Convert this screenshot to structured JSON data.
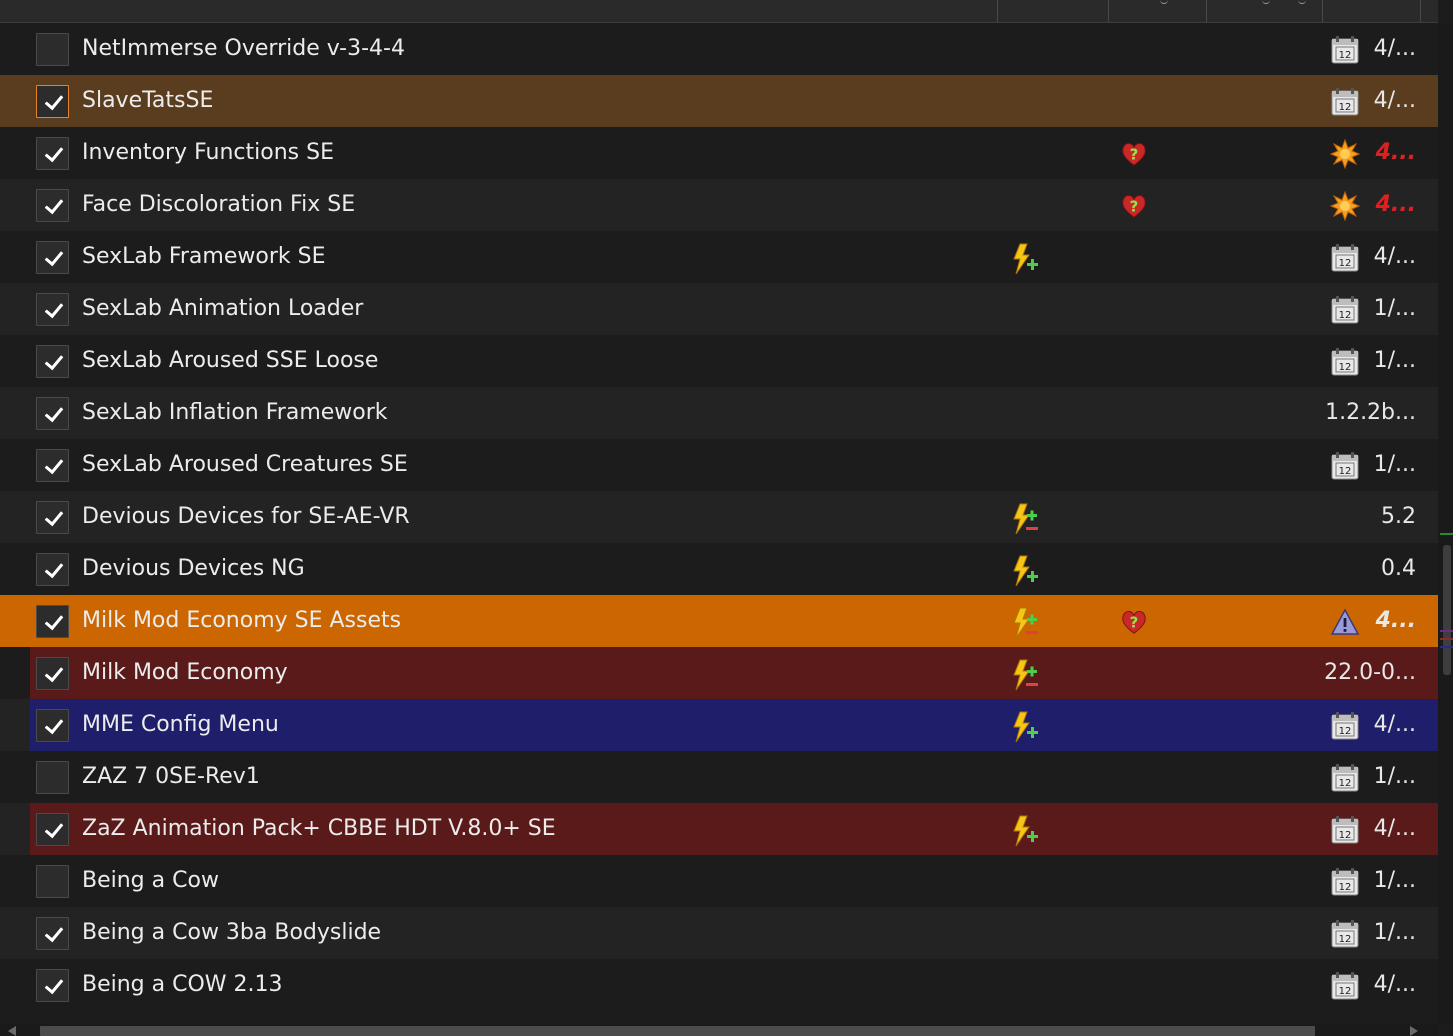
{
  "colors": {
    "row_selected": "#5a3c1e",
    "row_highlight_orange": "#cc6600",
    "row_highlight_darkred": "#5a1a1a",
    "row_highlight_blue": "#1e1e6a",
    "version_warning": "#e02020"
  },
  "mods": [
    {
      "name": "NetImmerse Override v-3-4-4",
      "enabled": false,
      "flag": "",
      "health": "",
      "version_icon": "calendar-icon",
      "version": "4/..."
    },
    {
      "name": "SlaveTatsSE",
      "enabled": true,
      "selected": true,
      "flag": "",
      "health": "",
      "version_icon": "calendar-icon",
      "version": "4/..."
    },
    {
      "name": "Inventory Functions SE",
      "enabled": true,
      "flag": "",
      "health": "heart-question-icon",
      "version_icon": "sunburst-icon",
      "version": "4...",
      "version_style": "warning"
    },
    {
      "name": "Face Discoloration Fix SE",
      "enabled": true,
      "flag": "",
      "health": "heart-question-icon",
      "version_icon": "sunburst-icon",
      "version": "4...",
      "version_style": "warning"
    },
    {
      "name": "SexLab Framework SE",
      "enabled": true,
      "flag": "conflict-plus-icon",
      "health": "",
      "version_icon": "calendar-icon",
      "version": "4/..."
    },
    {
      "name": "SexLab Animation Loader",
      "enabled": true,
      "flag": "",
      "health": "",
      "version_icon": "calendar-icon",
      "version": "1/..."
    },
    {
      "name": "SexLab Aroused SSE Loose",
      "enabled": true,
      "flag": "",
      "health": "",
      "version_icon": "calendar-icon",
      "version": "1/..."
    },
    {
      "name": "SexLab Inflation Framework",
      "enabled": true,
      "flag": "",
      "health": "",
      "version_icon": "",
      "version": "1.2.2b..."
    },
    {
      "name": "SexLab Aroused Creatures SE",
      "enabled": true,
      "flag": "",
      "health": "",
      "version_icon": "calendar-icon",
      "version": "1/..."
    },
    {
      "name": "Devious Devices for SE-AE-VR",
      "enabled": true,
      "flag": "conflict-plus-minus-icon",
      "health": "",
      "version_icon": "",
      "version": "5.2"
    },
    {
      "name": "Devious Devices NG",
      "enabled": true,
      "flag": "conflict-plus-icon",
      "health": "",
      "version_icon": "",
      "version": "0.4"
    },
    {
      "name": "Milk Mod Economy SE Assets",
      "enabled": true,
      "highlight": "orange",
      "flag": "conflict-plus-minus-icon",
      "health": "heart-question-icon",
      "version_icon": "warning-triangle-icon",
      "version": "4...",
      "version_style": "bold"
    },
    {
      "name": "Milk Mod Economy",
      "enabled": true,
      "highlight": "darkred",
      "flag": "conflict-plus-minus-icon",
      "health": "",
      "version_icon": "",
      "version": "22.0-0..."
    },
    {
      "name": "MME Config Menu",
      "enabled": true,
      "highlight": "blue",
      "flag": "conflict-plus-icon",
      "health": "",
      "version_icon": "calendar-icon",
      "version": "4/..."
    },
    {
      "name": "ZAZ 7 0SE-Rev1",
      "enabled": false,
      "flag": "",
      "health": "",
      "version_icon": "calendar-icon",
      "version": "1/..."
    },
    {
      "name": "ZaZ Animation Pack+ CBBE HDT V.8.0+ SE",
      "enabled": true,
      "highlight": "darkred",
      "flag": "conflict-plus-icon",
      "health": "",
      "version_icon": "calendar-icon",
      "version": "4/..."
    },
    {
      "name": "Being a Cow",
      "enabled": false,
      "flag": "",
      "health": "",
      "version_icon": "calendar-icon",
      "version": "1/..."
    },
    {
      "name": "Being a Cow 3ba Bodyslide",
      "enabled": true,
      "flag": "",
      "health": "",
      "version_icon": "calendar-icon",
      "version": "1/..."
    },
    {
      "name": "Being a COW 2.13",
      "enabled": true,
      "flag": "",
      "health": "",
      "version_icon": "calendar-icon",
      "version": "4/..."
    }
  ]
}
